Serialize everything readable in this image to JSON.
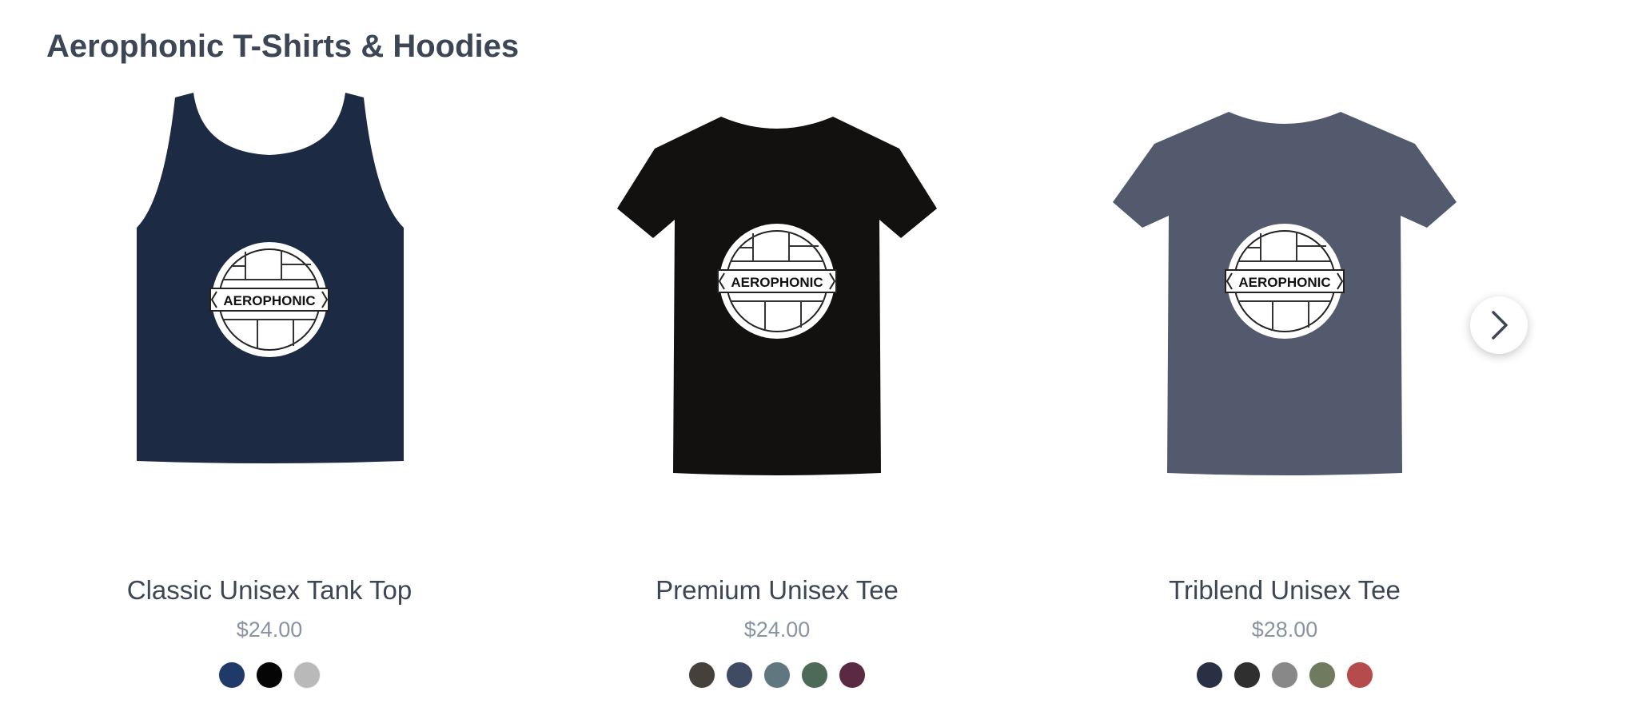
{
  "section": {
    "title": "Aerophonic T-Shirts & Hoodies"
  },
  "graphic": {
    "text": "AEROPHONIC"
  },
  "icons": {
    "next": "chevron-right-icon"
  },
  "products": [
    {
      "name": "Classic Unisex Tank Top",
      "price": "$24.00",
      "garment_color": "#1d2a44",
      "swatches": [
        {
          "color": "#1f3a68"
        },
        {
          "color": "#050505"
        },
        {
          "color": "#b9b9b9"
        }
      ]
    },
    {
      "name": "Premium Unisex Tee",
      "price": "$24.00",
      "garment_color": "#121110",
      "swatches": [
        {
          "color": "#45403a"
        },
        {
          "color": "#3f4a63"
        },
        {
          "color": "#617780"
        },
        {
          "color": "#4d6957"
        },
        {
          "color": "#5a2a43"
        }
      ]
    },
    {
      "name": "Triblend Unisex Tee",
      "price": "$28.00",
      "garment_color": "#535a6d",
      "swatches": [
        {
          "color": "#2a3043"
        },
        {
          "color": "#2f2f2f"
        },
        {
          "color": "#888888"
        },
        {
          "color": "#6f7a5e"
        },
        {
          "color": "#b54b4b"
        }
      ]
    }
  ]
}
